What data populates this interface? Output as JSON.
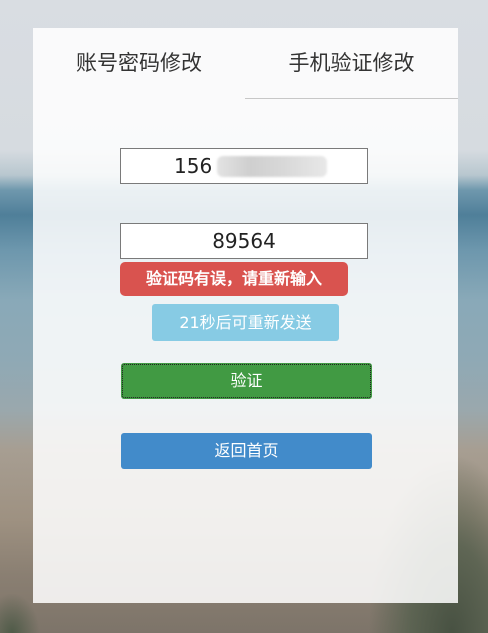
{
  "tabs": {
    "account_label": "账号密码修改",
    "phone_label": "手机验证修改"
  },
  "form": {
    "phone_value": "156",
    "code_value": "89564",
    "error_message": "验证码有误，请重新输入",
    "resend_label": "21秒后可重新发送",
    "verify_label": "验证",
    "home_label": "返回首页"
  },
  "colors": {
    "error": "#d9534f",
    "resend": "#87cbe4",
    "verify": "#419a43",
    "home": "#428bca"
  }
}
